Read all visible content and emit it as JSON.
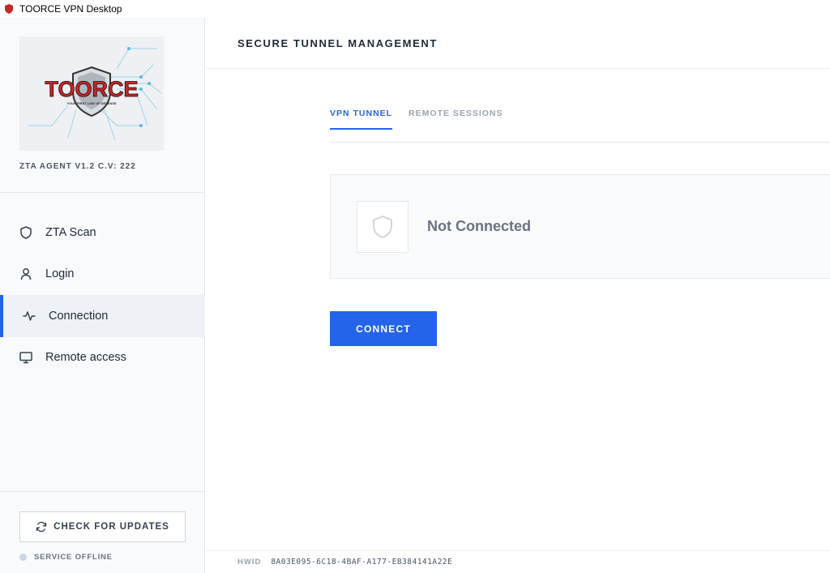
{
  "window": {
    "title": "TOORCE VPN Desktop"
  },
  "sidebar": {
    "logo_text": "TOORCE",
    "logo_tagline": "YOUR FIRST LINE OF DEFENSE",
    "agent_version": "ZTA AGENT V1.2 C.V: 222",
    "items": [
      {
        "label": "ZTA Scan",
        "icon": "shield-icon",
        "active": false
      },
      {
        "label": "Login",
        "icon": "user-icon",
        "active": false
      },
      {
        "label": "Connection",
        "icon": "activity-icon",
        "active": true
      },
      {
        "label": "Remote access",
        "icon": "monitor-icon",
        "active": false
      }
    ],
    "update_button": "CHECK FOR UPDATES",
    "service_status": "SERVICE OFFLINE"
  },
  "main": {
    "page_title": "SECURE TUNNEL MANAGEMENT",
    "tabs": [
      {
        "label": "VPN TUNNEL",
        "active": true
      },
      {
        "label": "REMOTE SESSIONS",
        "active": false
      }
    ],
    "status_text": "Not Connected",
    "connect_button": "CONNECT"
  },
  "footer": {
    "hwid_label": "HWID",
    "hwid_value": "8A03E095-6C18-4BAF-A177-EB384141A22E"
  },
  "colors": {
    "accent": "#2563eb",
    "sidebar_bg": "#f8fafc",
    "logo_red": "#c62828"
  }
}
